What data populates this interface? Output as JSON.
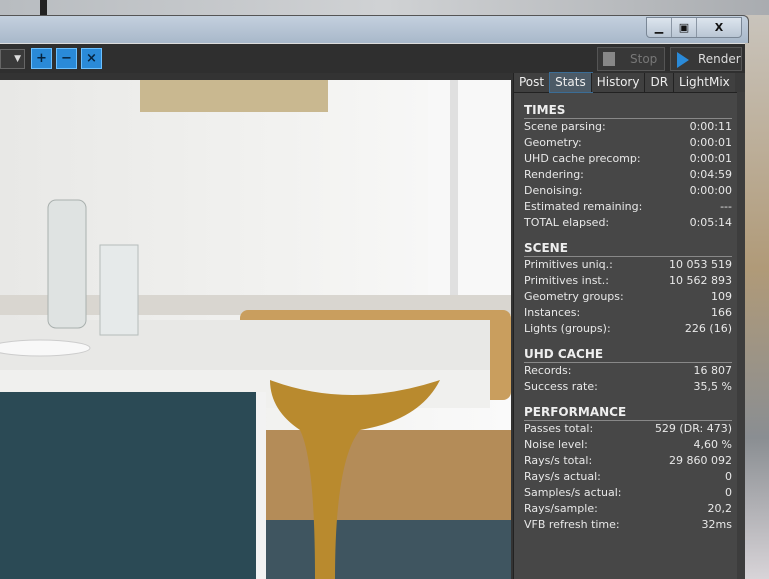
{
  "window": {
    "buttons": [
      "minimize",
      "maximize",
      "close"
    ],
    "close_label": "X"
  },
  "toolbar": {
    "zoom_in": "zoom-in",
    "zoom_out": "zoom-out",
    "zoom_reset": "zoom-reset",
    "stop_label": "Stop",
    "render_label": "Render",
    "accent": "#2a8ad8"
  },
  "tabs": [
    {
      "label": "Post"
    },
    {
      "label": "Stats",
      "active": true
    },
    {
      "label": "History"
    },
    {
      "label": "DR"
    },
    {
      "label": "LightMix"
    }
  ],
  "sections": [
    {
      "title": "TIMES",
      "rows": [
        [
          "Scene parsing:",
          "0:00:11"
        ],
        [
          "Geometry:",
          "0:00:01"
        ],
        [
          "UHD cache precomp:",
          "0:00:01"
        ],
        [
          "Rendering:",
          "0:04:59"
        ],
        [
          "Denoising:",
          "0:00:00"
        ],
        [
          "Estimated remaining:",
          "---"
        ],
        [
          "TOTAL elapsed:",
          "0:05:14"
        ]
      ]
    },
    {
      "title": "SCENE",
      "rows": [
        [
          "Primitives uniq.:",
          "10 053 519"
        ],
        [
          "Primitives inst.:",
          "10 562 893"
        ],
        [
          "Geometry groups:",
          "109"
        ],
        [
          "Instances:",
          "166"
        ],
        [
          "Lights (groups):",
          "226 (16)"
        ]
      ]
    },
    {
      "title": "UHD CACHE",
      "rows": [
        [
          "Records:",
          "16 807"
        ],
        [
          "Success rate:",
          "35,5 %"
        ]
      ]
    },
    {
      "title": "PERFORMANCE",
      "rows": [
        [
          "Passes total:",
          "529 (DR: 473)"
        ],
        [
          "Noise level:",
          "4,60 %"
        ],
        [
          "Rays/s total:",
          "29 860 092"
        ],
        [
          "Rays/s actual:",
          "0"
        ],
        [
          "Samples/s actual:",
          "0"
        ],
        [
          "Rays/sample:",
          "20,2"
        ],
        [
          "VFB refresh time:",
          "32ms"
        ]
      ]
    }
  ]
}
